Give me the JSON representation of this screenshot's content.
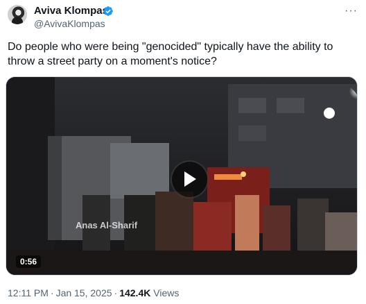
{
  "author": {
    "name": "Aviva Klompas",
    "handle": "@AvivaKlompas"
  },
  "more_label": "···",
  "tweet": {
    "text": "Do people who were being \"genocided\" typically have the ability to throw a street party on a moment's notice?"
  },
  "video": {
    "watermark": "Anas Al-Sharif",
    "duration": "0:56"
  },
  "meta": {
    "time": "12:11 PM",
    "date": "Jan 15, 2025",
    "views_count": "142.4K",
    "views_label": "Views"
  },
  "colors": {
    "verified": "#1d9bf0",
    "secondary_text": "#536471",
    "primary_text": "#0f1419"
  },
  "icons": [
    "verified-badge-icon",
    "more-icon",
    "play-icon"
  ]
}
